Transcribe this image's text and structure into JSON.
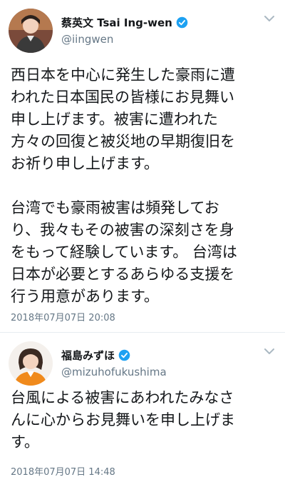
{
  "tweets": [
    {
      "display_name": "蔡英文 Tsai Ing-wen",
      "handle": "@iingwen",
      "verified": true,
      "avatar_icon": "person-avatar",
      "body_lines": [
        "西日本を中心に発生した豪雨に遭",
        "われた日本国民の皆様にお見舞い",
        "申し上げます。被害に遭われた",
        "方々の回復と被災地の早期復旧を",
        "お祈り申し上げます。",
        "",
        "台湾でも豪雨被害は頻発してお",
        "り、我々もその被害の深刻さを身",
        "をもって経験しています。 台湾は",
        "日本が必要とするあらゆる支援を",
        "行う用意があります。"
      ],
      "timestamp": "2018年07月07日 20:08"
    },
    {
      "display_name": "福島みずほ",
      "handle": "@mizuhofukushima",
      "verified": true,
      "avatar_icon": "person-avatar",
      "body_lines": [
        "台風による被害にあわれたみなさ",
        "んに心からお見舞いを申し上げま",
        "す。"
      ],
      "timestamp": "2018年07月07日 14:48"
    }
  ],
  "colors": {
    "verified": "#1da1f2",
    "secondary_text": "#657786",
    "primary_text": "#14171a",
    "divider": "#e6ecf0"
  }
}
